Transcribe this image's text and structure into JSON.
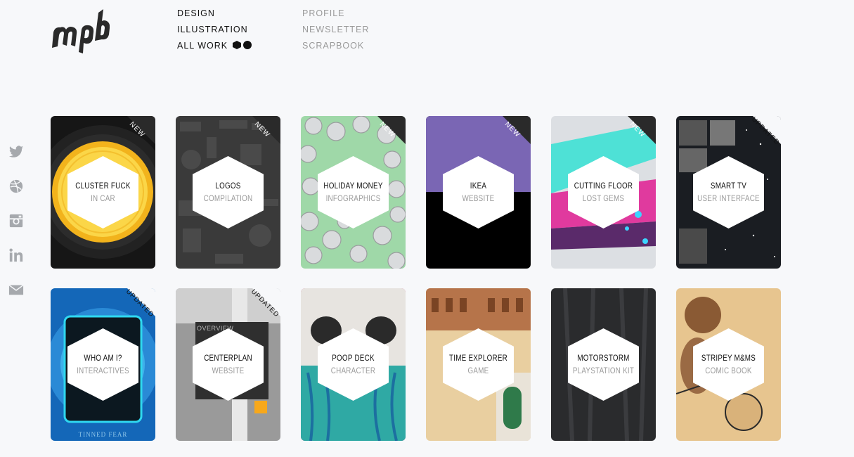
{
  "brand": {
    "logo_text": "mpb"
  },
  "nav": {
    "primary": [
      {
        "label": "DESIGN"
      },
      {
        "label": "ILLUSTRATION"
      },
      {
        "label": "ALL WORK"
      }
    ],
    "secondary": [
      {
        "label": "PROFILE"
      },
      {
        "label": "NEWSLETTER"
      },
      {
        "label": "SCRAPBOOK"
      }
    ]
  },
  "social": [
    "twitter-icon",
    "dribbble-icon",
    "instagram-icon",
    "linkedin-icon",
    "mail-icon"
  ],
  "cards": [
    {
      "title": "CLUSTER FUCK",
      "subtitle": "IN CAR",
      "badge": "NEW"
    },
    {
      "title": "LOGOS",
      "subtitle": "COMPILATION",
      "badge": "NEW"
    },
    {
      "title": "HOLIDAY MONEY",
      "subtitle": "INFOGRAPHICS",
      "badge": "NEW"
    },
    {
      "title": "IKEA",
      "subtitle": "WEBSITE",
      "badge": "NEW"
    },
    {
      "title": "CUTTING FLOOR",
      "subtitle": "LOST GEMS",
      "badge": "NEW"
    },
    {
      "title": "SMART TV",
      "subtitle": "USER INTERFACE",
      "badge": "UPDATED"
    },
    {
      "title": "WHO AM I?",
      "subtitle": "INTERACTIVES",
      "badge": "UPDATED",
      "art_text": "TINNED FEAR"
    },
    {
      "title": "CENTERPLAN",
      "subtitle": "WEBSITE",
      "badge": "UPDATED",
      "art_text": "OVERVIEW"
    },
    {
      "title": "POOP DECK",
      "subtitle": "CHARACTER",
      "badge": ""
    },
    {
      "title": "TIME EXPLORER",
      "subtitle": "GAME",
      "badge": ""
    },
    {
      "title": "MOTORSTORM",
      "subtitle": "PLAYSTATION KIT",
      "badge": ""
    },
    {
      "title": "STRIPEY M&MS",
      "subtitle": "COMIC BOOK",
      "badge": ""
    }
  ]
}
